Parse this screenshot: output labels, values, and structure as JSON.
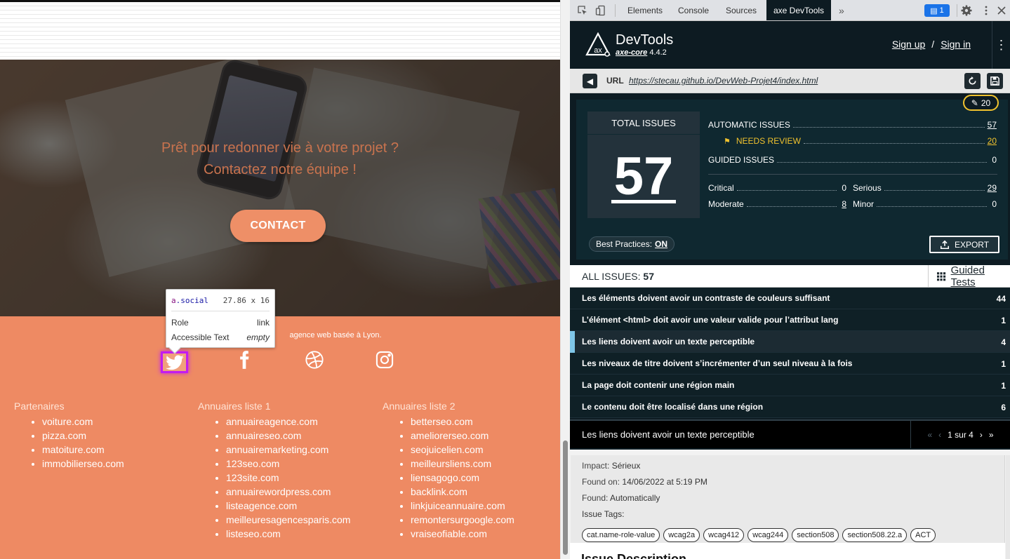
{
  "page": {
    "hero": {
      "tagline_line1": "Prêt pour redonner vie à votre projet ?",
      "tagline_line2": "Contactez notre équipe !",
      "contact_button": "CONTACT"
    },
    "footer": {
      "description": "agence web basée à Lyon.",
      "social_icons": [
        "twitter-icon",
        "facebook-icon",
        "dribbble-icon",
        "instagram-icon"
      ],
      "columns": [
        {
          "title": "Partenaires",
          "items": [
            "voiture.com",
            "pizza.com",
            "matoiture.com",
            "immobilierseo.com"
          ]
        },
        {
          "title": "Annuaires liste 1",
          "items": [
            "annuaireagence.com",
            "annuaireseo.com",
            "annuairemarketing.com",
            "123seo.com",
            "123site.com",
            "annuairewordpress.com",
            "listeagence.com",
            "meilleuresagencesparis.com",
            "listeseo.com"
          ]
        },
        {
          "title": "Annuaires liste 2",
          "items": [
            "betterseo.com",
            "ameliorerseo.com",
            "seojuicelien.com",
            "meilleursliens.com",
            "liensagogo.com",
            "backlink.com",
            "linkjuiceannuaire.com",
            "remontersurgoogle.com",
            "vraiseofiable.com"
          ]
        }
      ]
    },
    "tooltip": {
      "tag": "a",
      "class": ".social",
      "size": "27.86 x 16",
      "role_label": "Role",
      "role_value": "link",
      "text_label": "Accessible Text",
      "text_value": "empty"
    }
  },
  "devtools": {
    "tabs": [
      "Elements",
      "Console",
      "Sources",
      "axe DevTools"
    ],
    "active_tab": "axe DevTools",
    "more_tabs": "»",
    "issues_badge": "1",
    "axe": {
      "title": "DevTools",
      "core_label": "axe-core",
      "core_version": "4.4.2",
      "sign_up": "Sign up",
      "slash": "/",
      "sign_in": "Sign in",
      "url_label": "URL",
      "url": "https://stecau.github.io/DevWeb-Projet4/index.html",
      "review_pill": "20",
      "total_label": "TOTAL ISSUES",
      "total": "57",
      "automatic_label": "AUTOMATIC ISSUES",
      "automatic": "57",
      "needs_review_label": "NEEDS REVIEW",
      "needs_review": "20",
      "guided_label": "GUIDED ISSUES",
      "guided": "0",
      "critical_label": "Critical",
      "critical": "0",
      "serious_label": "Serious",
      "serious": "29",
      "moderate_label": "Moderate",
      "moderate": "8",
      "minor_label": "Minor",
      "minor": "0",
      "best_practices_label": "Best Practices:",
      "best_practices_value": "ON",
      "export_label": "EXPORT",
      "all_issues_label": "ALL ISSUES:",
      "all_issues_count": "57",
      "guided_tests": "Guided Tests",
      "issues": [
        {
          "label": "Les éléments doivent avoir un contraste de couleurs suffisant",
          "count": "44"
        },
        {
          "label": "L’élément <html> doit avoir une valeur valide pour l’attribut lang",
          "count": "1"
        },
        {
          "label": "Les liens doivent avoir un texte perceptible",
          "count": "4"
        },
        {
          "label": "Les niveaux de titre doivent s’incrémenter d’un seul niveau à la fois",
          "count": "1"
        },
        {
          "label": "La page doit contenir une région main",
          "count": "1"
        },
        {
          "label": "Le contenu doit être localisé dans une région",
          "count": "6"
        }
      ],
      "detail": {
        "title": "Les liens doivent avoir un texte perceptible",
        "pager": "1 sur 4",
        "impact_label": "Impact:",
        "impact": "Sérieux",
        "found_on_label": "Found on:",
        "found_on": "14/06/2022 at 5:19 PM",
        "found_label": "Found:",
        "found": "Automatically",
        "tags_label": "Issue Tags:",
        "tags": [
          "cat.name-role-value",
          "wcag2a",
          "wcag412",
          "wcag244",
          "section508",
          "section508.22.a",
          "ACT"
        ],
        "cut_heading": "Issue Description"
      }
    }
  },
  "colors": {
    "footer": "#ee8a63",
    "contact_button": "#ee8f67",
    "highlight": "#c21cf0",
    "axe_bg": "#0d1b22",
    "review_yellow": "#f1c22e",
    "selected_marker": "#7fc6e8"
  }
}
